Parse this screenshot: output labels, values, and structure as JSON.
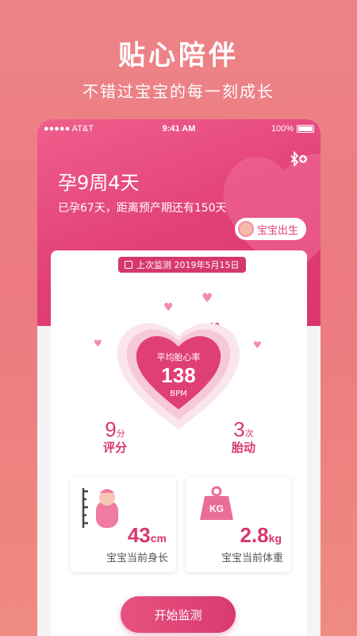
{
  "promo": {
    "title": "贴心陪伴",
    "subtitle": "不错过宝宝的每一刻成长"
  },
  "status_bar": {
    "carrier": "●●●●● AT&T",
    "time": "9:41 AM",
    "battery": "100%"
  },
  "header": {
    "week": "孕9周4天",
    "days_info": "已孕67天，距离预产期还有150天",
    "birth_button": "宝宝出生",
    "bluetooth_icon": "bluetooth-add-icon"
  },
  "monitor": {
    "last_check": "上次监测 2019年5月15日",
    "heart_label": "平均胎心率",
    "heart_rate": "138",
    "heart_unit": "BPM",
    "score_value": "9",
    "score_unit": "分",
    "score_label": "评分",
    "moves_value": "3",
    "moves_unit": "次",
    "moves_label": "胎动"
  },
  "metrics": {
    "height_value": "43",
    "height_unit": "cm",
    "height_label": "宝宝当前身长",
    "weight_value": "2.8",
    "weight_unit": "kg",
    "weight_label": "宝宝当前体重",
    "weight_icon_text": "KG"
  },
  "actions": {
    "start": "开始监测"
  },
  "colors": {
    "accent": "#d7376f",
    "background": "#ec8487"
  }
}
